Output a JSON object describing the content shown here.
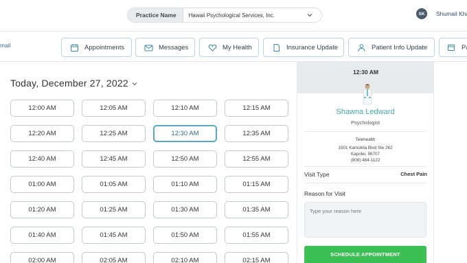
{
  "header": {
    "practice_label": "Practice Name",
    "practice_value": "Hawaii Psychological Services, Inc.",
    "user_initials": "SK",
    "user_name": "Shumail Khan"
  },
  "nav": {
    "left_text": "mail",
    "items": [
      {
        "label": "Appointments",
        "icon": "calendar-icon"
      },
      {
        "label": "Messages",
        "icon": "envelope-icon"
      },
      {
        "label": "My Health",
        "icon": "heart-icon"
      },
      {
        "label": "Insurance Update",
        "icon": "document-icon"
      },
      {
        "label": "Patient Info Update",
        "icon": "person-icon"
      },
      {
        "label": "Pa",
        "icon": "card-icon"
      }
    ]
  },
  "date_title": "Today, December 27, 2022",
  "slots": [
    "12:00 AM",
    "12:05 AM",
    "12:10 AM",
    "12:15 AM",
    "12:20 AM",
    "12:25 AM",
    "12:30 AM",
    "12:35 AM",
    "12:40 AM",
    "12:45 AM",
    "12:50 AM",
    "12:55 AM",
    "01:00 AM",
    "01:05 AM",
    "01:10 AM",
    "01:15 AM",
    "01:20 AM",
    "01:25 AM",
    "01:30 AM",
    "01:35 AM",
    "01:40 AM",
    "01:45 AM",
    "01:50 AM",
    "01:55 AM",
    "02:00 AM",
    "02:05 AM",
    "02:10 AM",
    "02:15 AM"
  ],
  "selected_slot": "12:30 AM",
  "panel": {
    "time": "12:30 AM",
    "doctor_name": "Shawna Ledward",
    "doctor_role": "Psychologist",
    "visit_mode": "Telehealth",
    "address_line1": "1001 Kamokila Blvd Ste 262",
    "address_line2": "Kapolei, 96707",
    "phone": "(808) 484-1122",
    "visit_type_label": "Visit Type",
    "visit_type_value": "Chest Pain",
    "reason_label": "Reason for Visit",
    "reason_placeholder": "Type your reason here",
    "schedule_label": "SCHEDULE APPOINTMENT"
  },
  "colors": {
    "accent": "#58a7c0",
    "doctor_name": "#48a4a8",
    "schedule_button": "#3cbf55"
  }
}
